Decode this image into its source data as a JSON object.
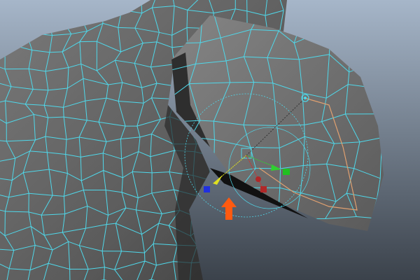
{
  "viewport": {
    "background_top": "#a6b6c9",
    "background_bottom": "#3b424b",
    "mesh_fill": "#6e6e6e",
    "wireframe_color": "#4fd8ea",
    "selected_edge_color": "#e0a070"
  },
  "manipulator": {
    "x_axis_color": "#d03030",
    "y_axis_color": "#30d030",
    "z_axis_color": "#2030e0",
    "center_handle_color": "#e0e020",
    "icons": [
      "move-manipulator-icon",
      "rotate-ring-icon",
      "pivot-point-icon"
    ]
  },
  "annotation": {
    "arrow_color": "#ff5a10",
    "icon": "arrow-up-icon"
  }
}
